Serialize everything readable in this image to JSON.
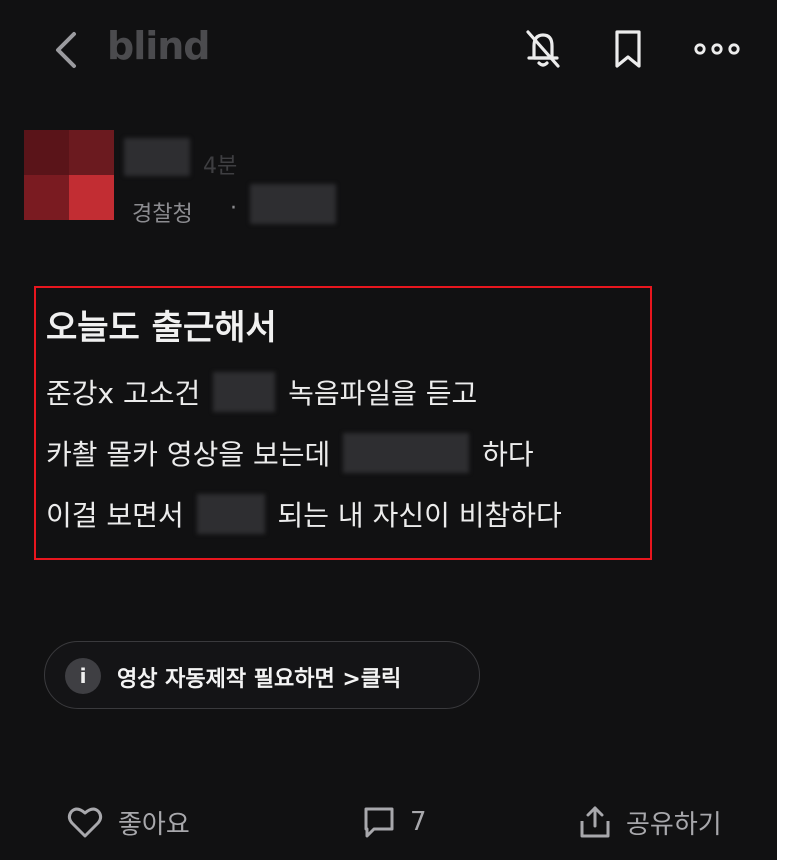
{
  "header": {
    "logo": "blind",
    "back_icon": "chevron-left-icon",
    "icons": [
      "bell-off-icon",
      "bookmark-icon",
      "more-horizontal-icon"
    ]
  },
  "author": {
    "time": "4분",
    "company": "경찰청",
    "separator": "·",
    "avatar_colors": [
      "#5a1419",
      "#6b1a1f",
      "#7a1b21",
      "#c22d33"
    ]
  },
  "post": {
    "title": "오늘도 출근해서",
    "lines": [
      {
        "before": "준강x 고소건",
        "after": "녹음파일을 듣고"
      },
      {
        "before": "카촬 몰카 영상을 보는데",
        "after": "하다"
      },
      {
        "before": "이걸 보면서",
        "after": "되는 내 자신이 비참하다"
      }
    ],
    "highlight_color": "#e8161e"
  },
  "promo": {
    "icon": "info-icon",
    "icon_glyph": "i",
    "label": "영상 자동제작 필요하면 >클릭"
  },
  "actions": {
    "like_label": "좋아요",
    "comment_count": "7",
    "share_label": "공유하기"
  },
  "colors": {
    "background": "#111112",
    "text": "#e8e8e8",
    "muted": "#8c8c90"
  }
}
